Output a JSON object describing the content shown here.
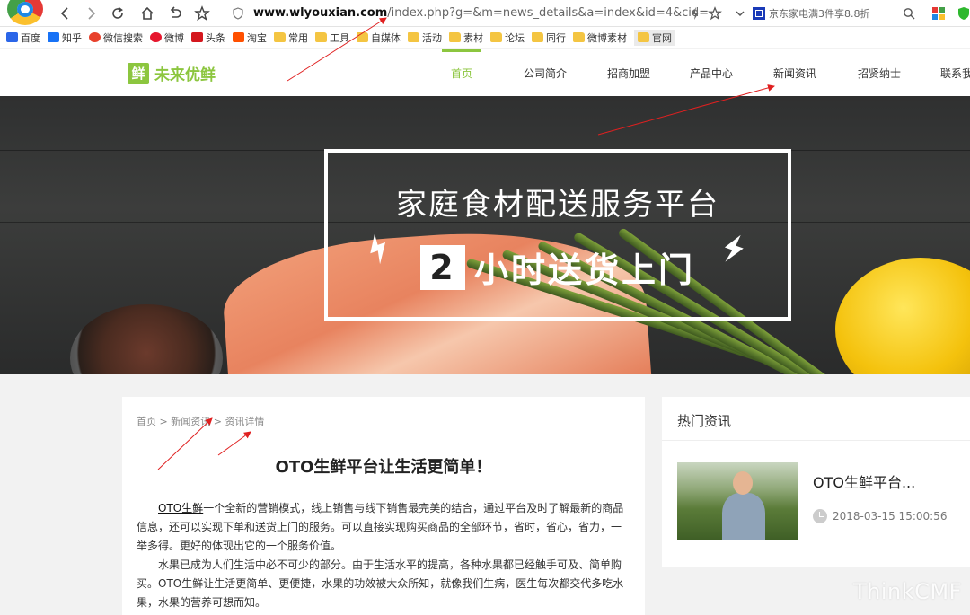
{
  "browser": {
    "url_host": "www.wlyouxian.com",
    "url_path": "/index.php?g=&m=news_details&a=index&id=4&cid=",
    "search_engine_text": "京东家电满3件享8.8折"
  },
  "bookmarks": [
    {
      "label": "百度",
      "icon": "baidu-icon"
    },
    {
      "label": "知乎",
      "icon": "zhihu-icon"
    },
    {
      "label": "微信搜索",
      "icon": "sogou-icon"
    },
    {
      "label": "微博",
      "icon": "weibo-icon"
    },
    {
      "label": "头条",
      "icon": "toutiao-icon"
    },
    {
      "label": "淘宝",
      "icon": "taobao-icon"
    },
    {
      "label": "常用",
      "icon": "folder-icon"
    },
    {
      "label": "工具",
      "icon": "folder-icon"
    },
    {
      "label": "自媒体",
      "icon": "folder-icon"
    },
    {
      "label": "活动",
      "icon": "folder-icon"
    },
    {
      "label": "素材",
      "icon": "folder-icon"
    },
    {
      "label": "论坛",
      "icon": "folder-icon"
    },
    {
      "label": "同行",
      "icon": "folder-icon"
    },
    {
      "label": "微博素材",
      "icon": "folder-icon"
    },
    {
      "label": "官网",
      "icon": "folder-icon"
    }
  ],
  "site": {
    "logo_mark": "鲜",
    "logo_text": "未来优鲜",
    "accent_color": "#8cc63f",
    "nav": [
      "首页",
      "公司简介",
      "招商加盟",
      "产品中心",
      "新闻资讯",
      "招贤纳士",
      "联系我"
    ]
  },
  "banner": {
    "title": "家庭食材配送服务平台",
    "sub_num": "2",
    "sub_text": "小时送货上门"
  },
  "article": {
    "breadcrumb": [
      "首页",
      "新闻资讯",
      "资讯详情"
    ],
    "breadcrumb_sep": ">",
    "title": "OTO生鲜平台让生活更简单！",
    "p1_keyword": "OTO生鲜",
    "p1_rest": "一个全新的营销模式，线上销售与线下销售最完美的结合，通过平台及时了解最新的商品信息，还可以实现下单和送货上门的服务。可以直接实现购买商品的全部环节，省时，省心，省力，一举多得。更好的体现出它的一个服务价值。",
    "p2": "水果已成为人们生活中必不可少的部分。由于生活水平的提高，各种水果都已经触手可及、简单购买。OTO生鲜让生活更简单、更便捷，水果的功效被大众所知，就像我们生病，医生每次都交代多吃水果，水果的营养可想而知。"
  },
  "sidebar": {
    "title": "热门资讯",
    "hot_item_title": "OTO生鲜平台...",
    "hot_item_time": "2018-03-15 15:00:56"
  },
  "watermark": "ThinkCMF",
  "annotation_color": "#e02020"
}
